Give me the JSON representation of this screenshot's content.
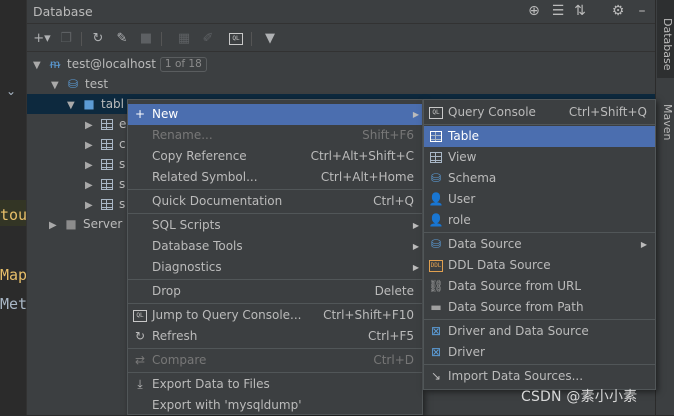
{
  "colors": {
    "background": "#2b2b2b",
    "panel": "#3c3f41",
    "selection": "#4b6eaf",
    "tree_selection": "#0d293e",
    "text": "#bbbbbb",
    "disabled_text": "#777777"
  },
  "editor": {
    "fragment_1": "tou",
    "fragment_2": "Map",
    "fragment_3": "Met"
  },
  "panel": {
    "title": "Database",
    "header_icons": [
      "globe-icon",
      "collapse-all-icon",
      "expand-all-icon",
      "settings-icon",
      "hide-icon"
    ],
    "toolbar_icons": [
      "add-icon",
      "duplicate-icon",
      "refresh-icon",
      "schema-sync-icon",
      "stop-icon",
      "table-icon",
      "edit-icon",
      "console-icon",
      "filter-icon"
    ]
  },
  "tree": {
    "connection": "test@localhost",
    "connection_badge": "1 of 18",
    "schema": "test",
    "folder": "tables",
    "folder_visible": "tabl",
    "table_rows": [
      "e",
      "c",
      "s",
      "s",
      "s"
    ],
    "server_objects": "Server"
  },
  "right_stripe": {
    "database_tab": "Database",
    "maven_tab": "Maven"
  },
  "main_menu": {
    "new": "New",
    "rename": "Rename...",
    "rename_shortcut": "Shift+F6",
    "copy_reference": "Copy Reference",
    "copy_reference_shortcut": "Ctrl+Alt+Shift+C",
    "related_symbol": "Related Symbol...",
    "related_symbol_shortcut": "Ctrl+Alt+Home",
    "quick_documentation": "Quick Documentation",
    "quick_documentation_shortcut": "Ctrl+Q",
    "sql_scripts": "SQL Scripts",
    "database_tools": "Database Tools",
    "diagnostics": "Diagnostics",
    "drop": "Drop",
    "drop_shortcut": "Delete",
    "jump_to_console": "Jump to Query Console...",
    "jump_to_console_shortcut": "Ctrl+Shift+F10",
    "refresh": "Refresh",
    "refresh_shortcut": "Ctrl+F5",
    "compare": "Compare",
    "compare_shortcut": "Ctrl+D",
    "export_data": "Export Data to Files",
    "export_mysqldump": "Export with 'mysqldump'"
  },
  "sub_menu": {
    "query_console": "Query Console",
    "query_console_shortcut": "Ctrl+Shift+Q",
    "table": "Table",
    "view": "View",
    "schema": "Schema",
    "user": "User",
    "role": "role",
    "data_source": "Data Source",
    "ddl_data_source": "DDL Data Source",
    "data_source_url": "Data Source from URL",
    "data_source_path": "Data Source from Path",
    "driver_and_data_source": "Driver and Data Source",
    "driver": "Driver",
    "import_data_sources": "Import Data Sources..."
  },
  "watermark": "CSDN @素小小素"
}
